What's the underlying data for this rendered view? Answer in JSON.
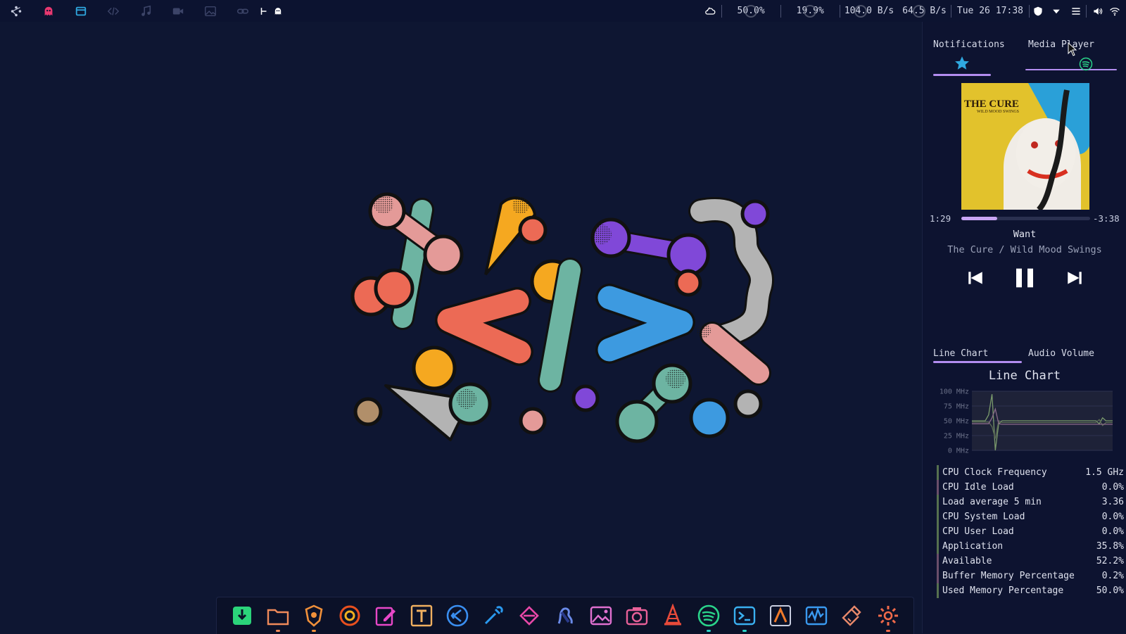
{
  "topbar": {
    "workspaces": [
      {
        "icon": "logo-icon",
        "color": "#c8cde0"
      },
      {
        "icon": "ghost-icon",
        "color": "#e83870"
      },
      {
        "icon": "window-icon",
        "color": "#2fa8e0"
      },
      {
        "icon": "code-icon",
        "color": "#3c4468"
      },
      {
        "icon": "music-icon",
        "color": "#3c4468"
      },
      {
        "icon": "video-icon",
        "color": "#3c4468"
      },
      {
        "icon": "image-icon",
        "color": "#3c4468"
      },
      {
        "icon": "link-icon",
        "color": "#3c4468"
      }
    ],
    "tray": {
      "cpu": "50.0%",
      "mem": "19.9%",
      "net_down": "104.0 B/s",
      "net_up": "64.5 B/s",
      "date": "Tue 26",
      "time": "17:38"
    }
  },
  "panel": {
    "tabs": [
      "Notifications",
      "Media Player"
    ],
    "player": {
      "album_art_text": "THE CURE",
      "album_art_subtext": "WILD MOOD SWINGS",
      "elapsed": "1:29",
      "remaining": "-3:38",
      "progress": 0.28,
      "title": "Want",
      "artist_album": "The Cure / Wild Mood Swings"
    },
    "lower_tabs": [
      "Line Chart",
      "Audio Volume"
    ],
    "chart_title": "Line Chart",
    "chart_data": {
      "type": "line",
      "yticks": [
        "100 MHz",
        "75 MHz",
        "50 MHz",
        "25 MHz",
        "0 MHz"
      ],
      "ylim": [
        0,
        100
      ],
      "series": [
        {
          "color": "#7a9a6c",
          "values": [
            50,
            50,
            50,
            50,
            50,
            60,
            95,
            0,
            45,
            50,
            50,
            50,
            50,
            50,
            50,
            50,
            50,
            50,
            50,
            50,
            50,
            50,
            50,
            50,
            50,
            50,
            50,
            50,
            50,
            50,
            50,
            50,
            50,
            50,
            50,
            50,
            50,
            50,
            45,
            55,
            50,
            50,
            50
          ]
        },
        {
          "color": "#5c6b56",
          "values": [
            48,
            48,
            48,
            48,
            48,
            48,
            40,
            20,
            50,
            47,
            47,
            47,
            47,
            47,
            47,
            47,
            47,
            47,
            47,
            47,
            47,
            47,
            47,
            47,
            47,
            47,
            47,
            47,
            47,
            47,
            47,
            47,
            47,
            47,
            47,
            47,
            47,
            47,
            52,
            42,
            47,
            47,
            47
          ]
        },
        {
          "color": "#8a6a8a",
          "values": [
            45,
            45,
            45,
            45,
            45,
            45,
            55,
            70,
            45,
            44,
            44,
            44,
            44,
            44,
            44,
            44,
            44,
            44,
            44,
            44,
            44,
            44,
            44,
            44,
            44,
            44,
            44,
            44,
            44,
            44,
            44,
            44,
            44,
            44,
            44,
            44,
            44,
            44,
            44,
            44,
            44,
            44,
            44
          ]
        }
      ]
    },
    "stats": [
      {
        "label": "CPU Clock Frequency",
        "value": "1.5 GHz",
        "color": "green"
      },
      {
        "label": "CPU Idle Load",
        "value": "0.0%",
        "color": "purple"
      },
      {
        "label": "Load average 5 min",
        "value": "3.36",
        "color": "green"
      },
      {
        "label": "CPU System Load",
        "value": "0.0%",
        "color": "green"
      },
      {
        "label": "CPU User Load",
        "value": "0.0%",
        "color": "green"
      },
      {
        "label": "Application",
        "value": "35.8%",
        "color": "green"
      },
      {
        "label": "Available",
        "value": "52.2%",
        "color": "purple"
      },
      {
        "label": "Buffer Memory Percentage",
        "value": "0.2%",
        "color": "purple"
      },
      {
        "label": "Used Memory Percentage",
        "value": "50.0%",
        "color": "green"
      }
    ]
  },
  "dock": [
    {
      "icon": "download-manager-icon",
      "color": "#2bd47a",
      "dot": ""
    },
    {
      "icon": "file-manager-icon",
      "color": "#f08a5a",
      "dot": "#f08a5a"
    },
    {
      "icon": "brave-browser-icon",
      "color": "#f0903a",
      "dot": "#f0903a"
    },
    {
      "icon": "firefox-icon",
      "color": "#e8501e",
      "dot": ""
    },
    {
      "icon": "text-editor-icon",
      "color": "#e848c8",
      "dot": ""
    },
    {
      "icon": "typora-icon",
      "color": "#f0b060",
      "dot": ""
    },
    {
      "icon": "vscode-icon",
      "color": "#3a8ef0",
      "dot": ""
    },
    {
      "icon": "color-picker-icon",
      "color": "#2a9af0",
      "dot": ""
    },
    {
      "icon": "diagram-icon",
      "color": "#e848a8",
      "dot": ""
    },
    {
      "icon": "kali-dragon-icon",
      "color": "#2a3a8a",
      "dot": ""
    },
    {
      "icon": "image-viewer-icon",
      "color": "#e070d0",
      "dot": ""
    },
    {
      "icon": "screenshot-icon",
      "color": "#e86098",
      "dot": ""
    },
    {
      "icon": "vlc-icon",
      "color": "#e84a3a",
      "dot": ""
    },
    {
      "icon": "spotify-icon",
      "color": "#2ad48a",
      "dot": "#2ad4c8"
    },
    {
      "icon": "terminal-icon",
      "color": "#3ab0f0",
      "dot": "#2ad4c8"
    },
    {
      "icon": "sublime-icon",
      "color": "#f07a2a",
      "dot": ""
    },
    {
      "icon": "system-monitor-icon",
      "color": "#3a9af0",
      "dot": ""
    },
    {
      "icon": "cleaner-icon",
      "color": "#e8886a",
      "dot": ""
    },
    {
      "icon": "settings-icon",
      "color": "#f06a4a",
      "dot": "#f06a4a"
    }
  ]
}
